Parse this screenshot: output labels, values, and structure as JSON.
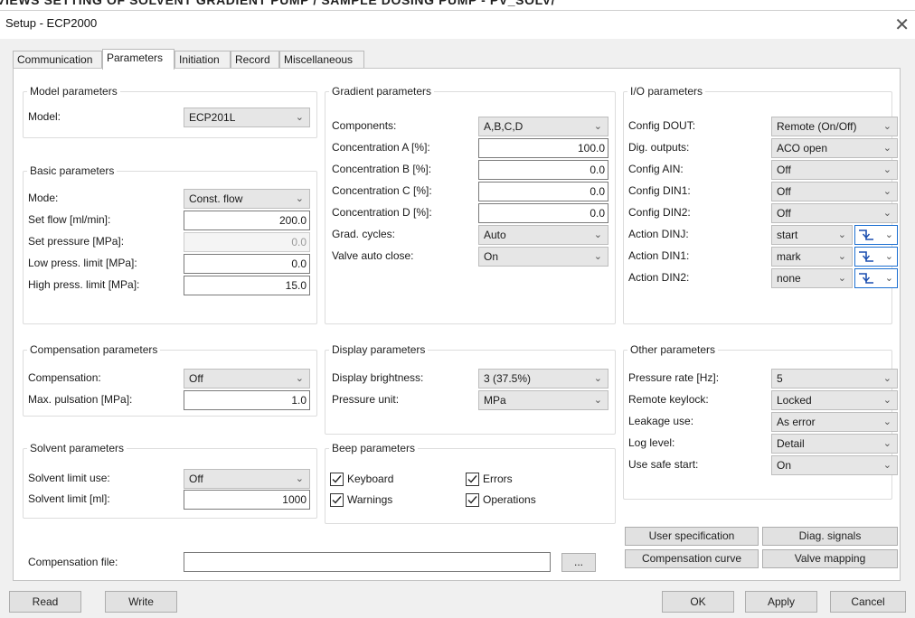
{
  "banner": "VIEWS SETTING OF SOLVENT GRADIENT PUMP / SAMPLE DOSING PUMP - PV_SOLV/",
  "window": {
    "title": "Setup - ECP2000",
    "close_glyph": "✕"
  },
  "tabs": [
    "Communication",
    "Parameters",
    "Initiation",
    "Record",
    "Miscellaneous"
  ],
  "active_tab": "Parameters",
  "model": {
    "title": "Model parameters",
    "model_label": "Model:",
    "model_value": "ECP201L"
  },
  "basic": {
    "title": "Basic parameters",
    "mode_label": "Mode:",
    "mode_value": "Const. flow",
    "set_flow_label": "Set flow [ml/min]:",
    "set_flow_value": "200.0",
    "set_pressure_label": "Set pressure [MPa]:",
    "set_pressure_value": "0.0",
    "low_limit_label": "Low press. limit [MPa]:",
    "low_limit_value": "0.0",
    "high_limit_label": "High press. limit [MPa]:",
    "high_limit_value": "15.0"
  },
  "compensation": {
    "title": "Compensation parameters",
    "comp_label": "Compensation:",
    "comp_value": "Off",
    "pulsation_label": "Max. pulsation [MPa]:",
    "pulsation_value": "1.0"
  },
  "solvent": {
    "title": "Solvent parameters",
    "use_label": "Solvent limit use:",
    "use_value": "Off",
    "limit_label": "Solvent limit [ml]:",
    "limit_value": "1000"
  },
  "comp_file": {
    "label": "Compensation file:",
    "value": "",
    "browse_label": "..."
  },
  "gradient": {
    "title": "Gradient parameters",
    "components_label": "Components:",
    "components_value": "A,B,C,D",
    "conc_a_label": "Concentration A [%]:",
    "conc_a_value": "100.0",
    "conc_b_label": "Concentration B [%]:",
    "conc_b_value": "0.0",
    "conc_c_label": "Concentration C [%]:",
    "conc_c_value": "0.0",
    "conc_d_label": "Concentration D [%]:",
    "conc_d_value": "0.0",
    "cycles_label": "Grad. cycles:",
    "cycles_value": "Auto",
    "valve_label": "Valve auto close:",
    "valve_value": "On"
  },
  "display": {
    "title": "Display parameters",
    "brightness_label": "Display brightness:",
    "brightness_value": "3 (37.5%)",
    "unit_label": "Pressure unit:",
    "unit_value": "MPa"
  },
  "beep": {
    "title": "Beep parameters",
    "keyboard_label": "Keyboard",
    "errors_label": "Errors",
    "warnings_label": "Warnings",
    "operations_label": "Operations",
    "keyboard_checked": true,
    "errors_checked": true,
    "warnings_checked": true,
    "operations_checked": true
  },
  "io": {
    "title": "I/O parameters",
    "config_dout_label": "Config DOUT:",
    "config_dout_value": "Remote (On/Off)",
    "dig_outputs_label": "Dig. outputs:",
    "dig_outputs_value": "ACO open",
    "config_ain_label": "Config AIN:",
    "config_ain_value": "Off",
    "config_din1_label": "Config DIN1:",
    "config_din1_value": "Off",
    "config_din2_label": "Config DIN2:",
    "config_din2_value": "Off",
    "action_dinj_label": "Action DINJ:",
    "action_dinj_value": "start",
    "action_din1_label": "Action DIN1:",
    "action_din1_value": "mark",
    "action_din2_label": "Action DIN2:",
    "action_din2_value": "none",
    "edge_icon": "falling-edge-icon"
  },
  "other": {
    "title": "Other parameters",
    "pressure_rate_label": "Pressure rate [Hz]:",
    "pressure_rate_value": "5",
    "keylock_label": "Remote keylock:",
    "keylock_value": "Locked",
    "leakage_label": "Leakage use:",
    "leakage_value": "As error",
    "log_label": "Log level:",
    "log_value": "Detail",
    "safe_start_label": "Use safe start:",
    "safe_start_value": "On"
  },
  "side_buttons": {
    "user_spec": "User specification",
    "diag": "Diag. signals",
    "comp_curve": "Compensation curve",
    "valve_map": "Valve mapping"
  },
  "footer": {
    "read": "Read",
    "write": "Write",
    "ok": "OK",
    "apply": "Apply",
    "cancel": "Cancel"
  },
  "colors": {
    "focus_border": "#1c6fd1",
    "panel_bg": "#ffffff",
    "window_bg": "#f0f0f0"
  }
}
